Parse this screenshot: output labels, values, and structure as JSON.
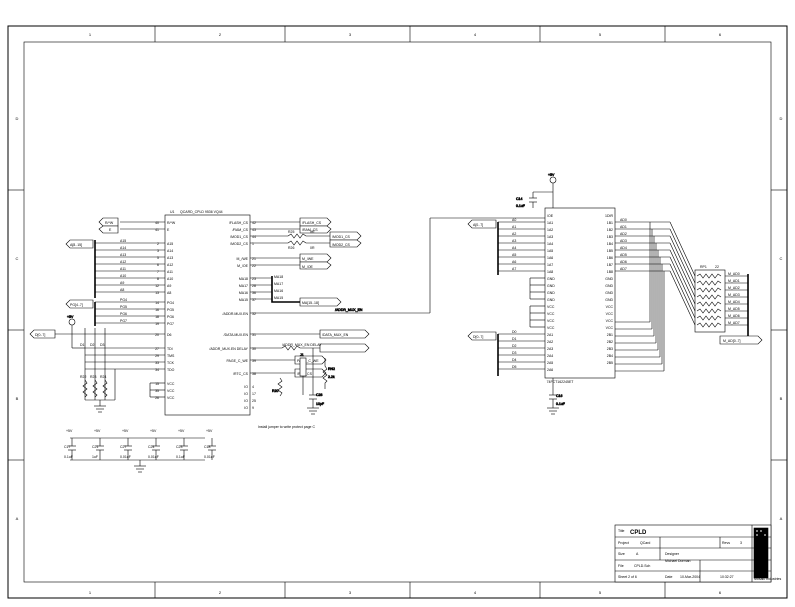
{
  "title_block": {
    "title_label": "Title",
    "title": "CPLD",
    "project_label": "Project",
    "project": "QCard",
    "size_label": "Size",
    "size": "A",
    "rev_label": "Revs",
    "rev": "3",
    "file_label": "File",
    "file": "CPLD.Sch",
    "sheet_label": "Sheet 2 of 6",
    "date_label": "Date",
    "date": "10-Mar-2004",
    "time": "10:32:27",
    "designer_label": "Designer",
    "designer": "Michael Dorman",
    "company": "Mosaic Industries"
  },
  "border": {
    "cols": [
      "1",
      "2",
      "3",
      "4",
      "5",
      "6"
    ],
    "rows": [
      "D",
      "C",
      "B",
      "A"
    ]
  },
  "u1": {
    "ref": "U1",
    "part": "QCARD_CPLD 9536 VQ44",
    "left": [
      {
        "n": "40",
        "name": "R/*W"
      },
      {
        "n": "41",
        "name": "E"
      },
      {
        "n": "2",
        "name": "A15"
      },
      {
        "n": "3",
        "name": "A14"
      },
      {
        "n": "5",
        "name": "A13"
      },
      {
        "n": "6",
        "name": "A12"
      },
      {
        "n": "7",
        "name": "A11"
      },
      {
        "n": "8",
        "name": "A10"
      },
      {
        "n": "12",
        "name": "A9"
      },
      {
        "n": "13",
        "name": "A8"
      },
      {
        "n": "14",
        "name": "PG4"
      },
      {
        "n": "16",
        "name": "PG5"
      },
      {
        "n": "18",
        "name": "PG6"
      },
      {
        "n": "19",
        "name": "PG7"
      },
      {
        "n": "20",
        "name": "D6"
      },
      {
        "n": "27",
        "name": "TDI"
      },
      {
        "n": "29",
        "name": "TMS"
      },
      {
        "n": "33",
        "name": "TCK"
      },
      {
        "n": "34",
        "name": "TDO"
      },
      {
        "n": "15",
        "name": "VCC"
      },
      {
        "n": "35",
        "name": "VCC"
      },
      {
        "n": "26",
        "name": "VCC"
      }
    ],
    "right": [
      {
        "n": "42",
        "name": "/FLASH_CS"
      },
      {
        "n": "43",
        "name": "/RAM_CS"
      },
      {
        "n": "44",
        "name": "/MOD1_CS"
      },
      {
        "n": "1",
        "name": "/MOD2_CS"
      },
      {
        "n": "21",
        "name": "M_/WE"
      },
      {
        "n": "22",
        "name": "M_/OE"
      },
      {
        "n": "23",
        "name": "MA18"
      },
      {
        "n": "28",
        "name": "MA17"
      },
      {
        "n": "36",
        "name": "MA16"
      },
      {
        "n": "37",
        "name": "MA15"
      },
      {
        "n": "32",
        "name": "/ADDR.MUX.EN"
      },
      {
        "n": "31",
        "name": "/DATA.MUX.EN"
      },
      {
        "n": "30",
        "name": "/ADDR_MUX.EN DELAY"
      },
      {
        "n": "39",
        "name": "PAGE_C_WE"
      },
      {
        "n": "38",
        "name": "/RTC_CS"
      },
      {
        "n": "4",
        "name": "IO"
      },
      {
        "n": "17",
        "name": "IO"
      },
      {
        "n": "25",
        "name": "IO"
      },
      {
        "n": "9",
        "name": "IO"
      },
      {
        "n": "10",
        "name": "IO"
      },
      {
        "n": "11",
        "name": "IO"
      }
    ]
  },
  "signals": {
    "flash": "/FLASH_CS",
    "ram": "/RAM_CS",
    "mod1": "/MOD1_CS",
    "mod2": "/MOD2_CS",
    "mwe": "M_/WE",
    "moe": "M_/OE",
    "ma": "MA[15..18]",
    "addrmux": "/ADDR_MUX_EN",
    "datamux": "/DATA_MUX_EN",
    "addrdelay": "/ADDR_MUX_EN DELAY",
    "pagec": "PAGE_C_WE",
    "rtc": "/RTC_CS",
    "rw": "R/*W",
    "e": "E",
    "abus": "A[8..15]",
    "pgbus": "PG[4..7]",
    "d6": "D6",
    "dbus": "D[0..7]",
    "madbus": "M_AD[0..7]"
  },
  "jtag": [
    "TDI",
    "TMS",
    "TCK",
    "TDO"
  ],
  "pwr": {
    "p5": "+5V",
    "gnd": "GND"
  },
  "caps": {
    "bank": [
      {
        "ref": "C17",
        "val": "0.1uF"
      },
      {
        "ref": "C21",
        "val": "1uF"
      },
      {
        "ref": "C27",
        "val": "0.01uF"
      },
      {
        "ref": "C24",
        "val": "0.01uF"
      },
      {
        "ref": "C23",
        "val": "0.1uF"
      },
      {
        "ref": "C18",
        "val": "0.01uF"
      }
    ],
    "c28": {
      "ref": "C28",
      "val": "10pF"
    },
    "c14": {
      "ref": "C14",
      "val": "0.1uF"
    },
    "c16": {
      "ref": "C16",
      "val": "0.1uF"
    }
  },
  "res": {
    "r22": {
      "ref": "R22",
      "val": ""
    },
    "r23": {
      "ref": "R23",
      "val": ""
    },
    "r24": {
      "ref": "R24",
      "val": ""
    },
    "mod": [
      {
        "ref": "R25",
        "val": "0R"
      },
      {
        "ref": "R26",
        "val": "0R"
      }
    ],
    "rdelay": {
      "ref": "R",
      "val": "0R/nop"
    },
    "rpagec": {
      "ref": "R20",
      "val": ""
    },
    "rn2": {
      "ref": "RN2",
      "val": "2.2k"
    },
    "rp1": {
      "ref": "RP1",
      "val": "22"
    }
  },
  "d_items": [
    {
      "ref": "D1",
      "val": ""
    },
    {
      "ref": "D2",
      "val": ""
    },
    {
      "ref": "D3",
      "val": ""
    }
  ],
  "jp": {
    "j1": "J1"
  },
  "note": "Install jumper to write protect page C",
  "u4": {
    "ref": "U4",
    "part": "74FCT162245ET",
    "left": [
      "/OE",
      "1A1",
      "1A2",
      "1A3",
      "1A4",
      "1A5",
      "1A6",
      "1A7",
      "1A8",
      "GND",
      "GND",
      "GND",
      "GND",
      "VCC",
      "VCC",
      "VCC",
      "VCC",
      "2A1",
      "2A2",
      "2A3",
      "2A4",
      "2A5",
      "2A6",
      "2A7",
      "2A8",
      "/OE"
    ],
    "right": [
      "1DIR",
      "1B1",
      "1B2",
      "1B3",
      "1B4",
      "1B5",
      "1B6",
      "1B7",
      "1B8",
      "GND",
      "GND",
      "GND",
      "GND",
      "VCC",
      "VCC",
      "VCC",
      "VCC",
      "2B1",
      "2B2",
      "2B3",
      "2B4",
      "2B5",
      "2B6",
      "2B7",
      "2B8",
      "2DIR"
    ],
    "lpins": [
      "1",
      "47",
      "46",
      "44",
      "43",
      "41",
      "40",
      "38",
      "37",
      "4",
      "10",
      "15",
      "21",
      "7",
      "18",
      "42",
      "31",
      "36",
      "35",
      "33",
      "32",
      "30",
      "29",
      "27",
      "26",
      "24"
    ],
    "rpins": [
      "48",
      "2",
      "3",
      "5",
      "6",
      "8",
      "9",
      "11",
      "12",
      "45",
      "39",
      "34",
      "28",
      "13",
      "14",
      "16",
      "17",
      "19",
      "20",
      "22",
      "23",
      "25"
    ]
  },
  "u4_sigs": {
    "left_a": [
      "A0",
      "A1",
      "A2",
      "A3",
      "A4",
      "A5",
      "A6",
      "A7"
    ],
    "left_d": [
      "D0",
      "D1",
      "D2",
      "D3",
      "D4",
      "D5",
      "D6",
      "D7"
    ],
    "right_ad": [
      "AD0",
      "AD1",
      "AD2",
      "AD3",
      "AD4",
      "AD5",
      "AD6",
      "AD7"
    ],
    "mad": [
      "M_AD0",
      "M_AD1",
      "M_AD2",
      "M_AD3",
      "M_AD4",
      "M_AD5",
      "M_AD6",
      "M_AD7"
    ]
  },
  "bus_labels": {
    "a07": "A[0..7]",
    "d07": "D[0..7]"
  }
}
